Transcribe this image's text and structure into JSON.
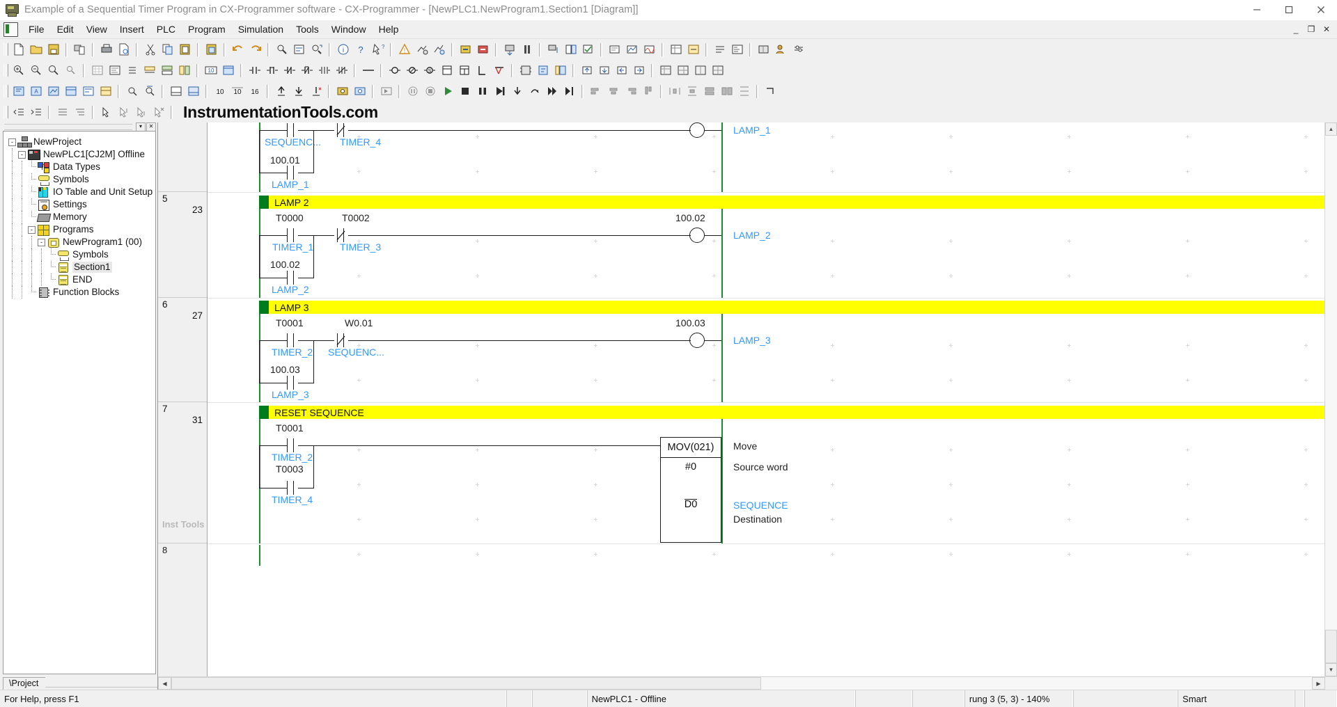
{
  "window": {
    "title": "Example of a Sequential Timer Program in CX-Programmer software - CX-Programmer - [NewPLC1.NewProgram1.Section1 [Diagram]]",
    "minimize": "minimize-button",
    "maximize": "maximize-button",
    "close": "close-button"
  },
  "menu": {
    "items": [
      {
        "label": "File"
      },
      {
        "label": "Edit"
      },
      {
        "label": "View"
      },
      {
        "label": "Insert"
      },
      {
        "label": "PLC"
      },
      {
        "label": "Program"
      },
      {
        "label": "Simulation"
      },
      {
        "label": "Tools"
      },
      {
        "label": "Window"
      },
      {
        "label": "Help"
      }
    ],
    "mdi": {
      "minimize": "_",
      "restore": "❐",
      "close": "✕"
    }
  },
  "branding": {
    "text": "InstrumentationTools.com"
  },
  "tree": {
    "nodes": [
      {
        "label": "NewProject",
        "icon": "project-icon",
        "indent": 0,
        "expander": "-"
      },
      {
        "label": "NewPLC1[CJ2M] Offline",
        "icon": "plc-icon",
        "indent": 1,
        "expander": "-"
      },
      {
        "label": "Data Types",
        "icon": "data-types-icon",
        "indent": 2,
        "expander": ""
      },
      {
        "label": "Symbols",
        "icon": "symbols-icon",
        "indent": 2,
        "expander": ""
      },
      {
        "label": "IO Table and Unit Setup",
        "icon": "io-table-icon",
        "indent": 2,
        "expander": ""
      },
      {
        "label": "Settings",
        "icon": "settings-icon",
        "indent": 2,
        "expander": ""
      },
      {
        "label": "Memory",
        "icon": "memory-icon",
        "indent": 2,
        "expander": ""
      },
      {
        "label": "Programs",
        "icon": "programs-icon",
        "indent": 2,
        "expander": "-"
      },
      {
        "label": "NewProgram1 (00)",
        "icon": "program-icon",
        "indent": 3,
        "expander": "-"
      },
      {
        "label": "Symbols",
        "icon": "symbols-icon",
        "indent": 4,
        "expander": ""
      },
      {
        "label": "Section1",
        "icon": "section-icon",
        "indent": 4,
        "expander": "",
        "selected": true
      },
      {
        "label": "END",
        "icon": "section-icon",
        "indent": 4,
        "expander": ""
      },
      {
        "label": "Function Blocks",
        "icon": "function-blocks-icon",
        "indent": 2,
        "expander": ""
      }
    ],
    "tab": "Project"
  },
  "ladder": {
    "gutter_watermark": "Inst Tools",
    "rungs": [
      {
        "number": "",
        "step": "",
        "comment": "",
        "has_comment_bar": false,
        "elements": {
          "contacts": [
            {
              "addr": "",
              "sym": "SEQUENC...",
              "type": "no"
            },
            {
              "addr": "",
              "sym": "TIMER_4",
              "type": "nc"
            },
            {
              "addr": "100.01",
              "sym": "LAMP_1",
              "type": "no"
            }
          ],
          "coil": {
            "addr": "",
            "sym": "LAMP_1"
          }
        }
      },
      {
        "number": "5",
        "step": "23",
        "comment": "LAMP 2",
        "has_comment_bar": true,
        "elements": {
          "contacts": [
            {
              "addr": "T0000",
              "sym": "TIMER_1",
              "type": "no"
            },
            {
              "addr": "T0002",
              "sym": "TIMER_3",
              "type": "nc"
            },
            {
              "addr": "100.02",
              "sym": "LAMP_2",
              "type": "no"
            }
          ],
          "coil": {
            "addr": "100.02",
            "sym": "LAMP_2"
          }
        }
      },
      {
        "number": "6",
        "step": "27",
        "comment": "LAMP 3",
        "has_comment_bar": true,
        "elements": {
          "contacts": [
            {
              "addr": "T0001",
              "sym": "TIMER_2",
              "type": "no"
            },
            {
              "addr": "W0.01",
              "sym": "SEQUENC...",
              "type": "nc"
            },
            {
              "addr": "100.03",
              "sym": "LAMP_3",
              "type": "no"
            }
          ],
          "coil": {
            "addr": "100.03",
            "sym": "LAMP_3"
          }
        }
      },
      {
        "number": "7",
        "step": "31",
        "comment": "RESET SEQUENCE",
        "has_comment_bar": true,
        "elements": {
          "contacts": [
            {
              "addr": "T0001",
              "sym": "TIMER_2",
              "type": "no"
            },
            {
              "addr": "T0003",
              "sym": "TIMER_4",
              "type": "no"
            }
          ],
          "instruction": {
            "mnemonic": "MOV(021)",
            "operand1": "#0",
            "operand2": "D0",
            "annotations": [
              {
                "text": "Move",
                "style": "dark"
              },
              {
                "text": "Source word",
                "style": "dark"
              },
              {
                "text": "SEQUENCE",
                "style": "sym"
              },
              {
                "text": "Destination",
                "style": "dark"
              }
            ]
          }
        }
      },
      {
        "number": "8",
        "step": "",
        "comment": "",
        "has_comment_bar": false,
        "elements": {}
      }
    ]
  },
  "statusbar": {
    "help": "For Help, press F1",
    "plc": "NewPLC1 - Offline",
    "rung": "rung 3 (5, 3)  - 140%",
    "mode": "Smart"
  },
  "colors": {
    "comment_bar": "#ffff00",
    "rung_marker": "#007c1e",
    "rail": "#1e8b2f",
    "symbol_text": "#3399ff",
    "address_text": "#7a4a10"
  }
}
